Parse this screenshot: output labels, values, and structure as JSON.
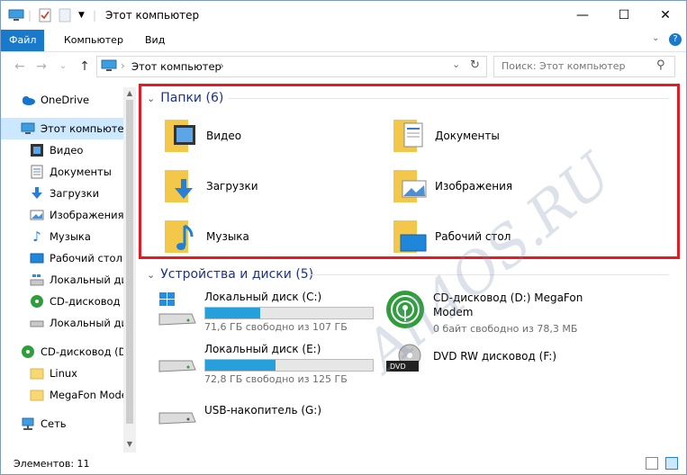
{
  "title": "Этот компьютер",
  "window_controls": [
    "—",
    "☐",
    "✕"
  ],
  "tabs": [
    {
      "label": "Файл",
      "active": true
    },
    {
      "label": "Компьютер",
      "active": false
    },
    {
      "label": "Вид",
      "active": false
    }
  ],
  "address": {
    "path": "Этот компьютер",
    "separator": "›"
  },
  "search": {
    "placeholder": "Поиск: Этот компьютер"
  },
  "sidebar": {
    "items": [
      {
        "label": "OneDrive",
        "icon": "cloud-icon",
        "level": 0
      },
      {
        "label": "Этот компьютер",
        "icon": "computer-icon",
        "level": 0,
        "selected": true
      },
      {
        "label": "Видео",
        "icon": "video-icon",
        "level": 1
      },
      {
        "label": "Документы",
        "icon": "documents-icon",
        "level": 1
      },
      {
        "label": "Загрузки",
        "icon": "downloads-icon",
        "level": 1
      },
      {
        "label": "Изображения",
        "icon": "pictures-icon",
        "level": 1
      },
      {
        "label": "Музыка",
        "icon": "music-icon",
        "level": 1
      },
      {
        "label": "Рабочий стол",
        "icon": "desktop-icon",
        "level": 1
      },
      {
        "label": "Локальный ди",
        "icon": "windows-drive-icon",
        "level": 1
      },
      {
        "label": "CD-дисковод (",
        "icon": "cd-drive-icon",
        "level": 1
      },
      {
        "label": "Локальный ди",
        "icon": "drive-icon",
        "level": 1
      },
      {
        "label": "CD-дисковод (D:",
        "icon": "cd-drive-icon",
        "level": 0
      },
      {
        "label": "Linux",
        "icon": "folder-icon",
        "level": 1
      },
      {
        "label": "MegaFon Mode",
        "icon": "folder-icon",
        "level": 1
      },
      {
        "label": "Сеть",
        "icon": "network-icon",
        "level": 0
      }
    ]
  },
  "folders_group": {
    "header": "Папки (6)",
    "items": [
      {
        "label": "Видео",
        "icon": "video-folder-icon"
      },
      {
        "label": "Документы",
        "icon": "documents-folder-icon"
      },
      {
        "label": "Загрузки",
        "icon": "downloads-folder-icon"
      },
      {
        "label": "Изображения",
        "icon": "pictures-folder-icon"
      },
      {
        "label": "Музыка",
        "icon": "music-folder-icon"
      },
      {
        "label": "Рабочий стол",
        "icon": "desktop-folder-icon"
      }
    ]
  },
  "devices_group": {
    "header": "Устройства и диски (5)",
    "items": [
      {
        "name": "Локальный диск (C:)",
        "free": "71,6 ГБ свободно из 107 ГБ",
        "used_fraction": 0.33,
        "icon": "windows-drive-icon"
      },
      {
        "name": "CD-дисковод (D:) MegaFon Modem",
        "free": "0 байт свободно из 78,3 МБ",
        "icon": "megafon-modem-icon"
      },
      {
        "name": "Локальный диск (E:)",
        "free": "72,8 ГБ свободно из 125 ГБ",
        "used_fraction": 0.42,
        "icon": "drive-icon"
      },
      {
        "name": "DVD RW дисковод (F:)",
        "free": "",
        "icon": "dvd-drive-icon"
      },
      {
        "name": "USB-накопитель (G:)",
        "free": "",
        "icon": "usb-drive-icon"
      }
    ]
  },
  "status": {
    "items_count": "Элементов: 11"
  },
  "watermark": "All4OS.RU",
  "colors": {
    "accent": "#1979ca",
    "highlight": "#e41b23",
    "bar": "#26a0da",
    "selected": "#cce8ff"
  }
}
